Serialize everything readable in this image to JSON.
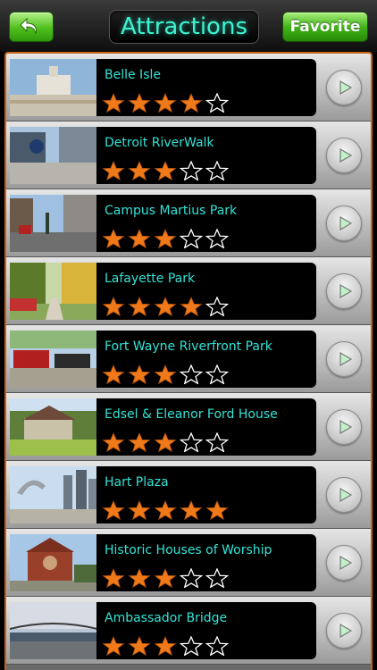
{
  "header": {
    "title": "Attractions",
    "favorite_label": "Favorite",
    "back_icon": "back-arrow-icon"
  },
  "colors": {
    "accent": "#33e3d6",
    "star": "#f07a1a",
    "button_green": "#43b51a"
  },
  "attractions": [
    {
      "name": "Belle Isle",
      "rating": 4
    },
    {
      "name": "Detroit RiverWalk",
      "rating": 3
    },
    {
      "name": "Campus Martius Park",
      "rating": 3
    },
    {
      "name": "Lafayette Park",
      "rating": 4
    },
    {
      "name": "Fort Wayne Riverfront Park",
      "rating": 3
    },
    {
      "name": "Edsel & Eleanor Ford House",
      "rating": 3
    },
    {
      "name": "Hart Plaza",
      "rating": 5
    },
    {
      "name": "Historic Houses of Worship",
      "rating": 3
    },
    {
      "name": "Ambassador Bridge",
      "rating": 3
    }
  ]
}
